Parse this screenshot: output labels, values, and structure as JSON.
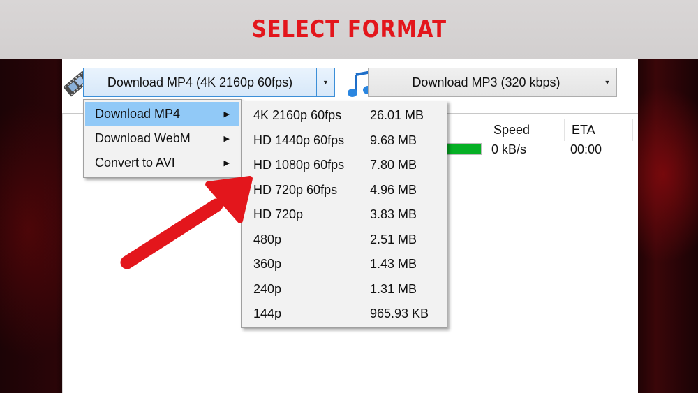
{
  "banner": {
    "title": "SELECT FORMAT"
  },
  "toolbar": {
    "mp4_combo": {
      "label": "Download MP4 (4K 2160p 60fps)",
      "arrow": "▼"
    },
    "mp3_combo": {
      "label": "Download MP3 (320 kbps)",
      "arrow": "▼"
    }
  },
  "list": {
    "columns": [
      "Speed",
      "ETA"
    ],
    "row": {
      "progress": 1.0,
      "speed": "0 kB/s",
      "eta": "00:00"
    }
  },
  "menu": {
    "items": [
      {
        "label": "Download MP4",
        "arrow": "▶",
        "active": true
      },
      {
        "label": "Download WebM",
        "arrow": "▶"
      },
      {
        "label": "Convert to AVI",
        "arrow": "▶"
      }
    ]
  },
  "submenu": {
    "items": [
      {
        "resolution": "4K 2160p 60fps",
        "size": "26.01 MB"
      },
      {
        "resolution": "HD 1440p 60fps",
        "size": "9.68 MB"
      },
      {
        "resolution": "HD 1080p 60fps",
        "size": "7.80 MB"
      },
      {
        "resolution": "HD 720p 60fps",
        "size": "4.96 MB"
      },
      {
        "resolution": "HD 720p",
        "size": "3.83 MB"
      },
      {
        "resolution": "480p",
        "size": "2.51 MB"
      },
      {
        "resolution": "360p",
        "size": "1.43 MB"
      },
      {
        "resolution": "240p",
        "size": "1.31 MB"
      },
      {
        "resolution": "144p",
        "size": "965.93 KB"
      }
    ]
  },
  "colors": {
    "accent": "#e3161c",
    "menu_highlight": "#91c9f7",
    "progress": "#06b025"
  },
  "icons": {
    "video": "film-strip-icon",
    "audio": "music-note-icon",
    "pointer": "red-arrow-icon"
  }
}
